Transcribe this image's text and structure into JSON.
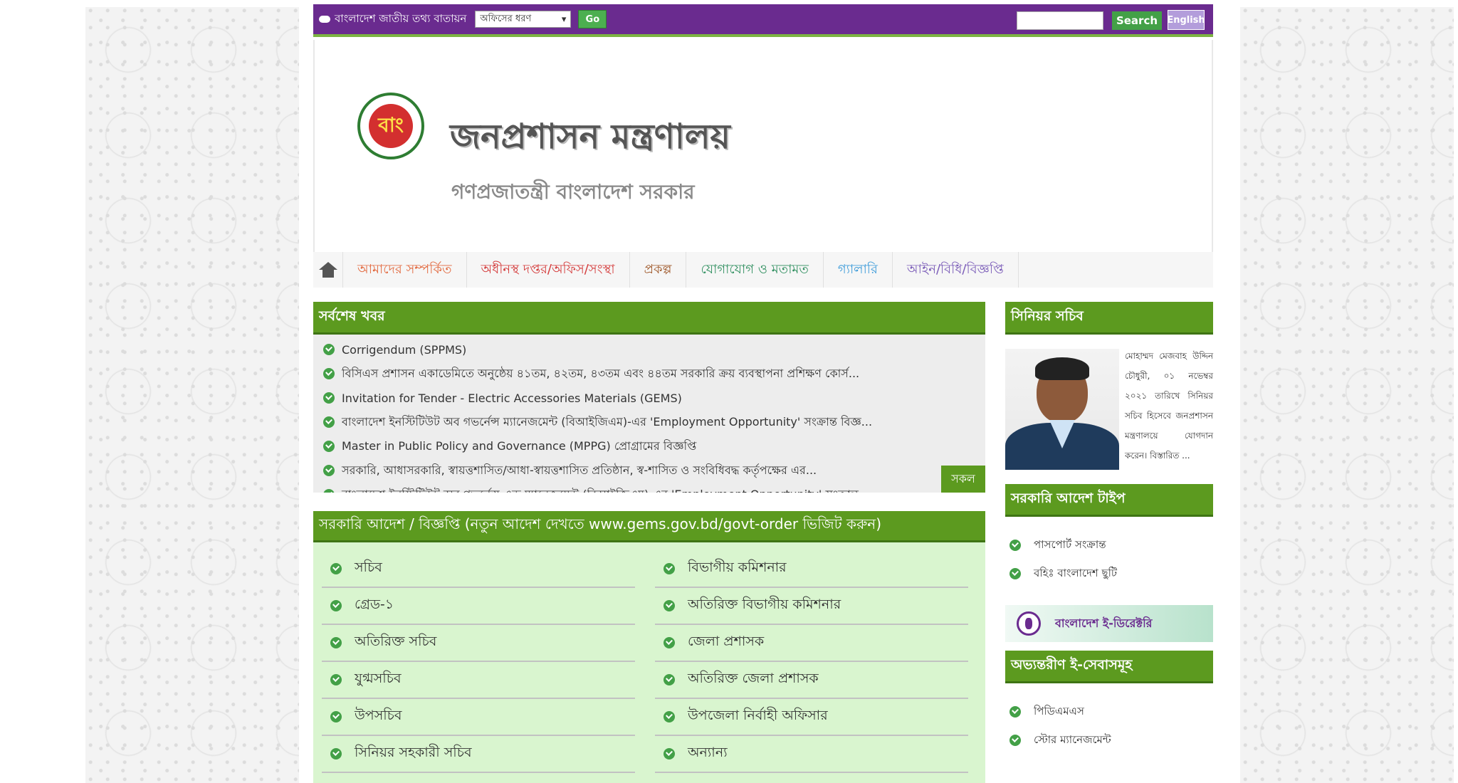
{
  "topbar": {
    "portal_label": "বাংলাদেশ জাতীয় তথ্য বাতায়ন",
    "office_select": "অফিসের ধরণ",
    "go_label": "Go",
    "search_label": "Search",
    "english_label": "English"
  },
  "header": {
    "title": "জনপ্রশাসন মন্ত্রণালয়",
    "subtitle": "গণপ্রজাতন্ত্রী বাংলাদেশ সরকার",
    "emblem_text": "বাং"
  },
  "nav": {
    "items": [
      "আমাদের সম্পর্কিত",
      "অধীনস্থ দপ্তর/অফিস/সংস্থা",
      "প্রকল্প",
      "যোগাযোগ ও মতামত",
      "গ্যালারি",
      "আইন/বিধি/বিজ্ঞপ্তি"
    ]
  },
  "news": {
    "title": "সর্বশেষ খবর",
    "items": [
      "Corrigendum (SPPMS)",
      "বিসিএস প্রশাসন একাডেমিতে অনুষ্ঠেয় ৪১তম, ৪২তম, ৪৩তম এবং ৪৪তম সরকারি ক্রয় ব্যবস্থাপনা প্রশিক্ষণ কোর্স...",
      "Invitation for Tender - Electric Accessories Materials (GEMS)",
      "বাংলাদেশ ইনস্টিটিউট অব গভর্নেন্স ম্যানেজমেন্ট (বিআইজিএম)-এর 'Employment Opportunity' সংক্রান্ত বিজ্ঞ...",
      "Master in Public Policy and Governance (MPPG) প্রোগ্রামের বিজ্ঞপ্তি",
      "সরকারি, আধাসরকারি, স্বায়ত্তশাসিত/আধা-স্বায়ত্তশাসিত প্রতিষ্ঠান, স্ব-শাসিত ও সংবিধিবদ্ধ কর্তৃপক্ষের এর...",
      "বাংলাদেশ ইনস্টিটিউট অব গভর্নেন্স এন্ড ম্যানেজমেন্ট (বিআইজিএম)-এর 'Employment Opportunity' সংক্রান্ত"
    ],
    "all_label": "সকল"
  },
  "orders": {
    "title": "সরকারি আদেশ / বিজ্ঞপ্তি (নতুন আদেশ দেখতে www.gems.gov.bd/govt-order ভিজিট করুন)",
    "left": [
      "সচিব",
      "গ্রেড-১",
      "অতিরিক্ত সচিব",
      "যুগ্মসচিব",
      "উপসচিব",
      "সিনিয়র সহকারী সচিব"
    ],
    "right": [
      "বিভাগীয় কমিশনার",
      "অতিরিক্ত বিভাগীয় কমিশনার",
      "জেলা প্রশাসক",
      "অতিরিক্ত জেলা প্রশাসক",
      "উপজেলা নির্বাহী অফিসার",
      "অন্যান্য"
    ]
  },
  "secretary": {
    "title": "সিনিয়র সচিব",
    "bio": "মোহাম্মদ মেজবাহ উদ্দিন চৌধুরী, ০১ নভেম্বর ২০২১ তারিখে সিনিয়র সচিব হিসেবে জনপ্রশাসন মন্ত্রণালয়ে যোগদান করেন। বিস্তারিত ..."
  },
  "gov_time": {
    "title": "সরকারি আদেশ টাইপ",
    "items": [
      "পাসপোর্ট সংক্রান্ত",
      "বহিঃ বাংলাদেশ ছুটি"
    ]
  },
  "banner": {
    "label": "বাংলাদেশ ই-ডিরেক্টরি"
  },
  "eservices": {
    "title": "অভ্যন্তরীণ ই-সেবাসমূহ",
    "items": [
      "পিডিএমএস",
      "স্টোর ম্যানেজমেন্ট"
    ]
  },
  "colors": {
    "topbar": "#6a2b8f",
    "accent_green": "#5c9a1f",
    "orders_bg": "#d9f5cf"
  }
}
